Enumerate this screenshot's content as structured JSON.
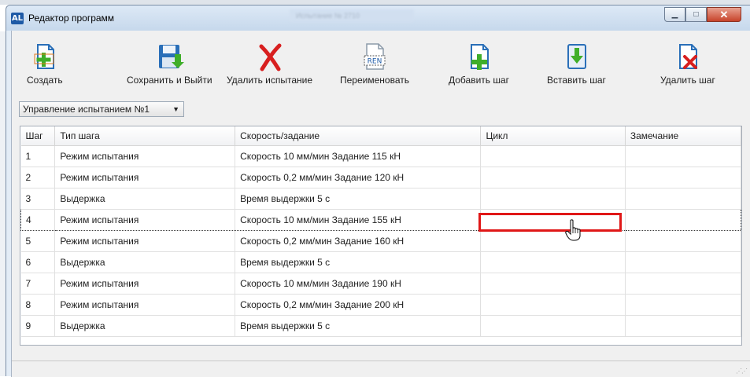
{
  "window": {
    "title": "Редактор программ",
    "title_blurred": "Испытание № 2710",
    "app_icon_glyph": "AL",
    "controls": {
      "minimize": "▁",
      "maximize": "□",
      "close": "✕"
    }
  },
  "toolbar": {
    "create": "Создать",
    "save_exit": "Сохранить и Выйти",
    "delete_test": "Удалить испытание",
    "rename": "Переименовать",
    "rename_icon_text": "REN",
    "add_step": "Добавить шаг",
    "insert_step": "Вставить шаг",
    "delete_step": "Удалить шаг"
  },
  "test_select": {
    "value": "Управление испытанием №1",
    "arrow": "▼"
  },
  "table": {
    "columns": [
      "Шаг",
      "Тип шага",
      "Скорость/задание",
      "Цикл",
      "Замечание"
    ],
    "rows": [
      {
        "step": "1",
        "type": "Режим испытания",
        "speed": "Скорость 10 мм/мин Задание 115 кН",
        "cycle": "",
        "note": ""
      },
      {
        "step": "2",
        "type": "Режим испытания",
        "speed": "Скорость 0,2 мм/мин Задание 120 кН",
        "cycle": "",
        "note": ""
      },
      {
        "step": "3",
        "type": "Выдержка",
        "speed": " Время выдержки 5 с",
        "cycle": "",
        "note": ""
      },
      {
        "step": "4",
        "type": "Режим испытания",
        "speed": "Скорость 10 мм/мин Задание 155 кН",
        "cycle": "",
        "note": ""
      },
      {
        "step": "5",
        "type": "Режим испытания",
        "speed": "Скорость 0,2 мм/мин Задание 160 кН",
        "cycle": "",
        "note": ""
      },
      {
        "step": "6",
        "type": "Выдержка",
        "speed": " Время выдержки 5 с",
        "cycle": "",
        "note": ""
      },
      {
        "step": "7",
        "type": "Режим испытания",
        "speed": "Скорость 10 мм/мин Задание 190 кН",
        "cycle": "",
        "note": ""
      },
      {
        "step": "8",
        "type": "Режим испытания",
        "speed": "Скорость 0,2 мм/мин Задание 200 кН",
        "cycle": "",
        "note": ""
      },
      {
        "step": "9",
        "type": "Выдержка",
        "speed": " Время выдержки 5 с",
        "cycle": "",
        "note": ""
      }
    ],
    "selected_row": 3
  },
  "colors": {
    "highlight": "#e01717",
    "accent_green": "#3fae2a",
    "delete_red": "#d81f1f",
    "icon_blue": "#2a6fb8"
  }
}
